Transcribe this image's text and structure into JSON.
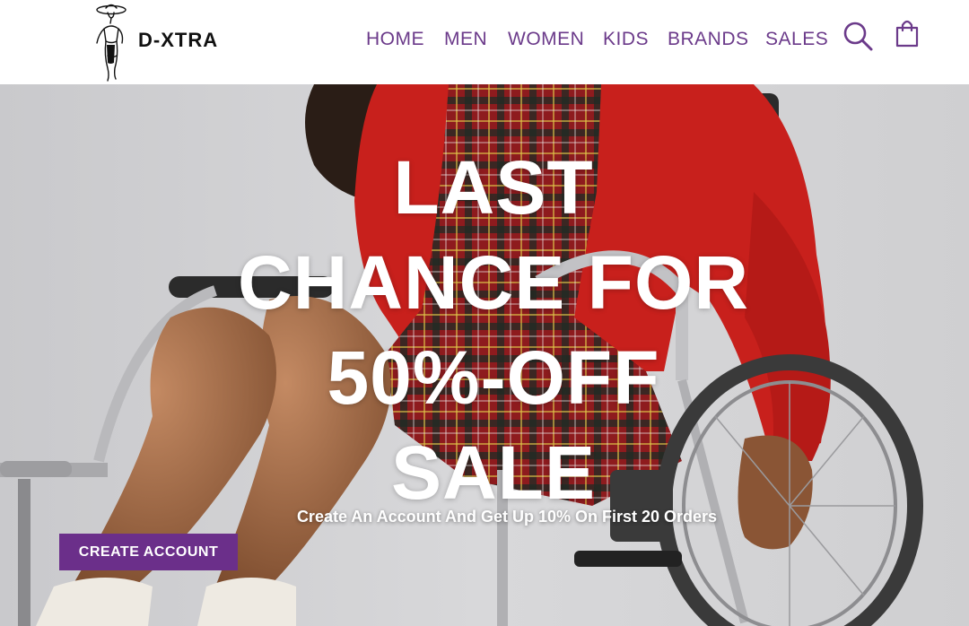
{
  "brand": {
    "name": "D-XTRA",
    "logo_icon": "fashion-woman-figure-icon"
  },
  "nav": {
    "items": [
      {
        "label": "HOME"
      },
      {
        "label": "MEN"
      },
      {
        "label": "WOMEN"
      },
      {
        "label": "KIDS"
      },
      {
        "label": "BRANDS"
      },
      {
        "label": "SALES"
      }
    ],
    "search_icon": "search-icon",
    "cart_icon": "shopping-bag-icon"
  },
  "hero": {
    "title_lines": [
      "LAST",
      "CHANCE FOR",
      "50%-OFF",
      "SALE"
    ],
    "subtitle": "Create An Account And Get Up 10% On First 20 Orders",
    "cta_label": "CREATE ACCOUNT",
    "image_description": "person in red sweater and plaid pinafore seated in a wheelchair"
  },
  "colors": {
    "accent": "#6b2f8a",
    "nav_text": "#6b3a8a",
    "hero_bg": "#d3d3d5",
    "sweater_red": "#c8201c"
  }
}
